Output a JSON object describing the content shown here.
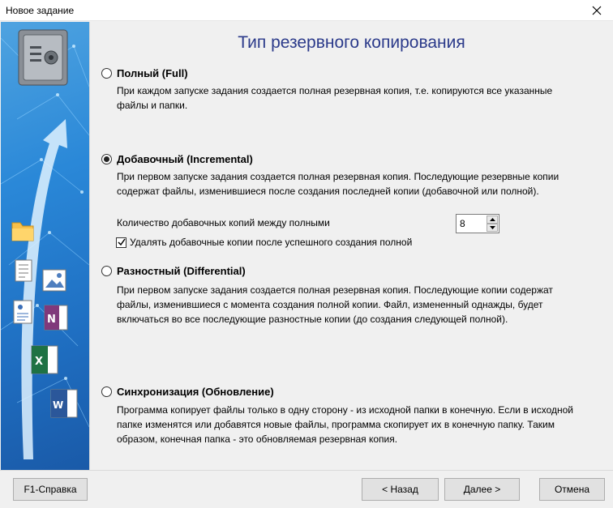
{
  "window": {
    "title": "Новое задание"
  },
  "heading": "Тип резервного копирования",
  "options": [
    {
      "label": "Полный (Full)",
      "checked": false,
      "description": [
        "При каждом запуске задания создается полная резервная копия, т.е. копируются все указанные",
        "файлы и папки."
      ]
    },
    {
      "label": "Добавочный (Incremental)",
      "checked": true,
      "description": [
        "При первом запуске задания создается полная резервная копия. Последующие резервные копии",
        "содержат файлы, изменившиеся после создания последней копии (добавочной или полной)."
      ]
    },
    {
      "label": "Разностный (Differential)",
      "checked": false,
      "description": [
        "При первом запуске задания создается полная резервная копия. Последующие копии содержат",
        "файлы, изменившиеся с момента создания полной копии. Файл, измененный однажды, будет",
        "включаться во все последующие разностные копии (до создания следующей полной)."
      ]
    },
    {
      "label": "Синхронизация (Обновление)",
      "checked": false,
      "description": [
        "Программа копирует файлы только в одну сторону - из исходной папки в конечную. Если в исходной",
        "папке изменятся или добавятся новые файлы, программа скопирует их в конечную папку. Таким",
        "образом, конечная папка - это обновляемая резервная копия."
      ]
    }
  ],
  "incremental": {
    "count_label": "Количество добавочных копий между полными",
    "count_value": "8",
    "delete_label": "Удалять добавочные копии после успешного создания полной",
    "delete_checked": true
  },
  "buttons": {
    "help": "F1-Справка",
    "back": "< Назад",
    "next": "Далее >",
    "cancel": "Отмена"
  },
  "sidebar_icons": [
    "safe-icon",
    "folder-icon",
    "document-icon",
    "image-icon",
    "contacts-icon",
    "onenote-icon",
    "excel-icon",
    "word-icon"
  ],
  "colors": {
    "heading": "#2b3a8a",
    "sidebar": "#2a88d8"
  }
}
